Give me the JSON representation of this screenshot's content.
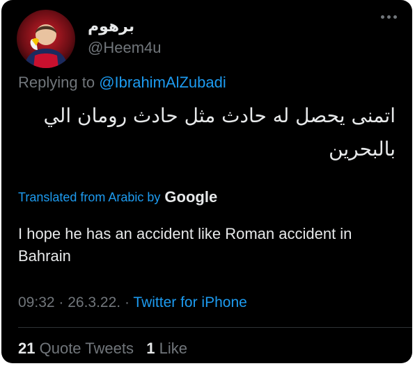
{
  "tweet": {
    "display_name": "برهوم",
    "handle": "@Heem4u",
    "replying_prefix": "Replying to",
    "replying_to": "@IbrahimAlZubadi",
    "text_arabic": "اتمنى يحصل له حادث مثل حادث رومان الي بالبحرين",
    "translated_label": "Translated from Arabic by",
    "translated_provider": "Google",
    "translation": "I hope he has an accident like Roman accident in Bahrain",
    "time": "09:32 · 26.3.22. · ",
    "source": "Twitter for iPhone",
    "quote_count": "21",
    "quote_label": "Quote Tweets",
    "like_count": "1",
    "like_label": "Like"
  },
  "icons": {
    "more": "more-horizontal-icon",
    "avatar": "avatar"
  },
  "colors": {
    "background": "#000000",
    "primary_text": "#e7e9ea",
    "secondary_text": "#71767b",
    "link": "#1d9bf0"
  }
}
